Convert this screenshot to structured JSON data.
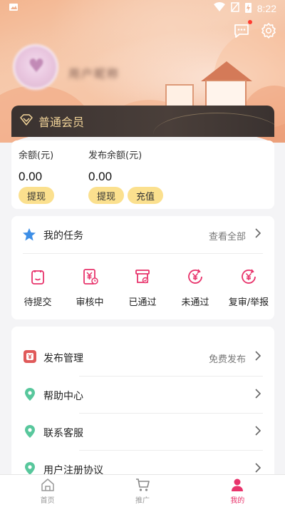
{
  "status_bar": {
    "time": "8:22"
  },
  "profile": {
    "nickname": "用户昵称"
  },
  "vip": {
    "label": "普通会员"
  },
  "balance": {
    "balance_title": "余额(元)",
    "balance_value": "0.00",
    "withdraw_label": "提现",
    "publish_title": "发布余额(元)",
    "publish_value": "0.00",
    "publish_withdraw_label": "提现",
    "recharge_label": "充值"
  },
  "tasks": {
    "title": "我的任务",
    "view_all": "查看全部",
    "items": [
      {
        "label": "待提交",
        "icon": "clipboard-icon"
      },
      {
        "label": "审核中",
        "icon": "yen-clock-icon"
      },
      {
        "label": "已通过",
        "icon": "box-check-icon"
      },
      {
        "label": "未通过",
        "icon": "yen-refresh-icon"
      },
      {
        "label": "复审/举报",
        "icon": "yen-refresh-icon"
      }
    ]
  },
  "menu": {
    "items": [
      {
        "label": "发布管理",
        "extra": "免费发布",
        "icon": "wallet-icon"
      },
      {
        "label": "帮助中心",
        "extra": "",
        "icon": "location-pin-icon"
      },
      {
        "label": "联系客服",
        "extra": "",
        "icon": "location-pin-icon"
      },
      {
        "label": "用户注册协议",
        "extra": "",
        "icon": "location-pin-icon"
      }
    ]
  },
  "nav": {
    "items": [
      {
        "label": "首页",
        "icon": "home-icon",
        "active": false
      },
      {
        "label": "推广",
        "icon": "cart-icon",
        "active": false
      },
      {
        "label": "我的",
        "icon": "user-icon",
        "active": true
      }
    ]
  },
  "colors": {
    "accent": "#e8336b",
    "gold_pill": "#fbe08e",
    "vip_text": "#f3d59a",
    "menu_green": "#58c79c",
    "menu_red": "#e05a5a"
  }
}
